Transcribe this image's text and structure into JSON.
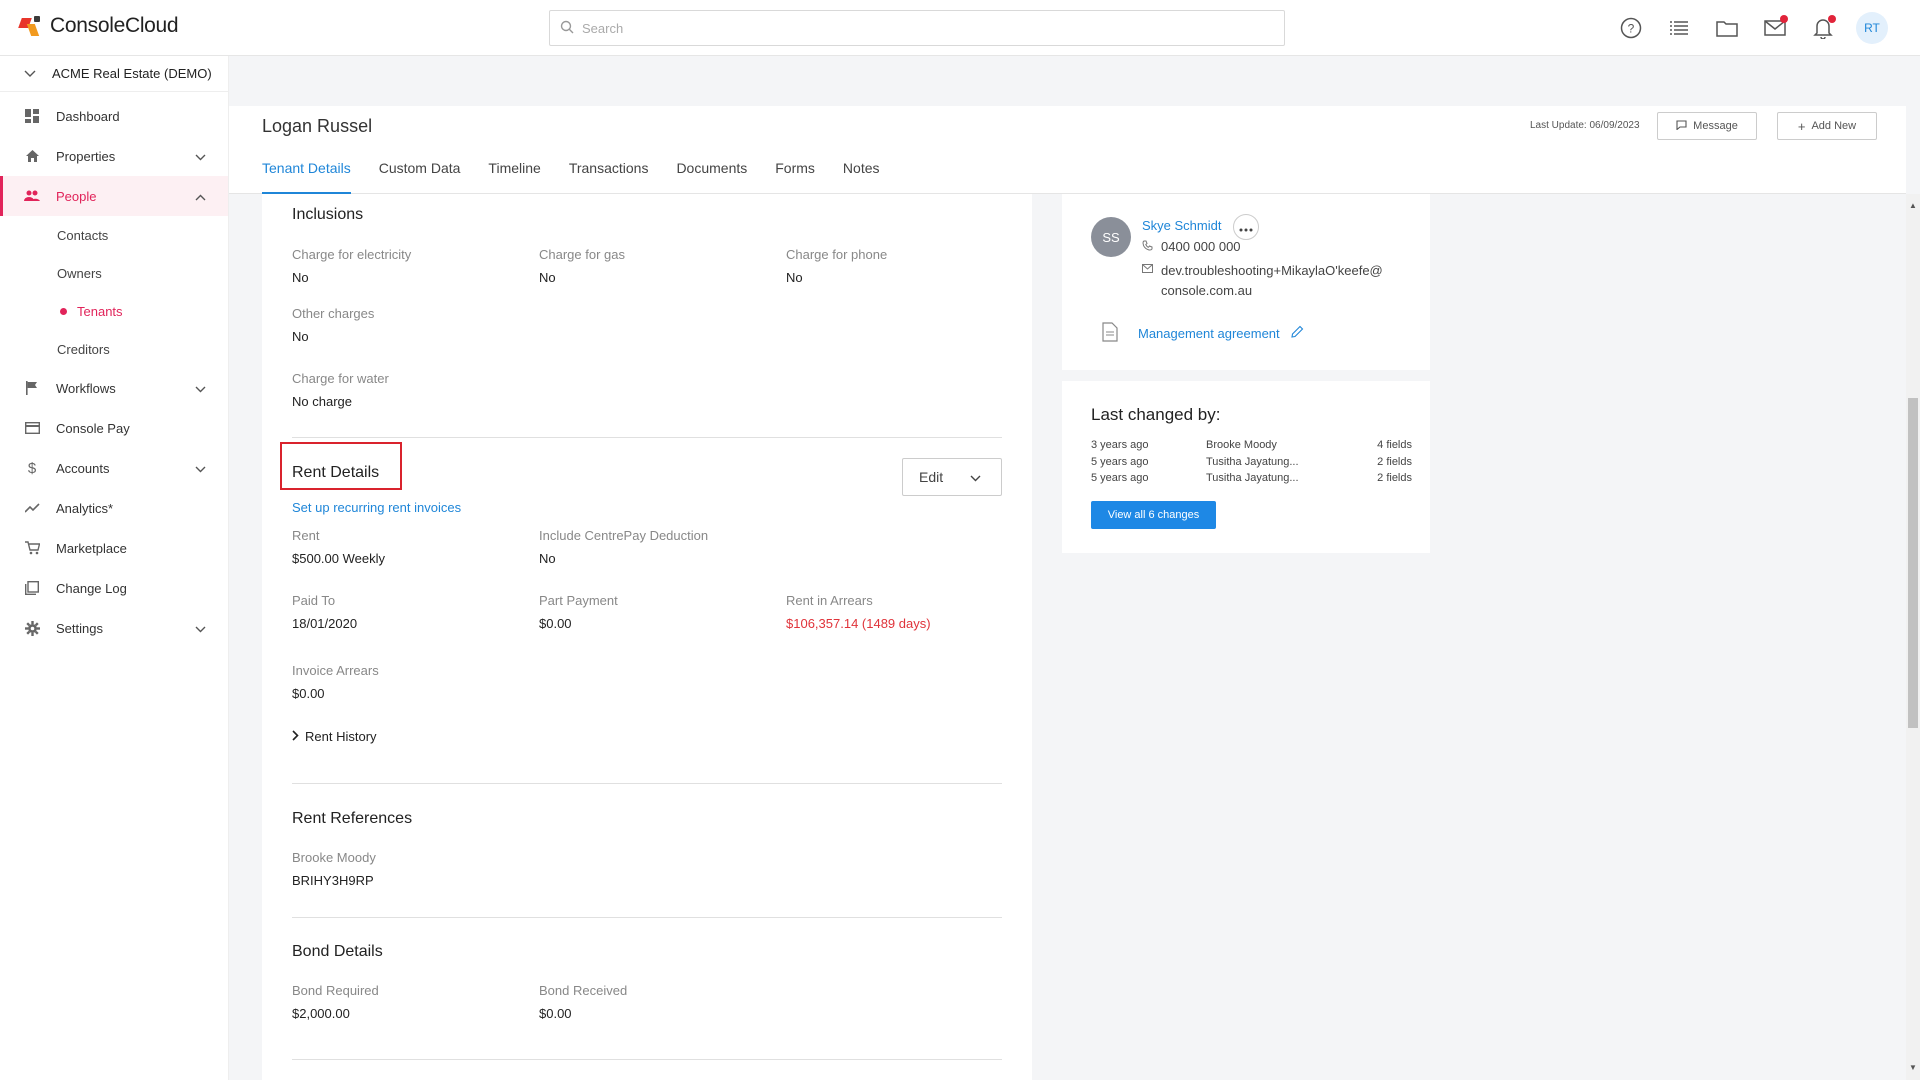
{
  "app": {
    "logo_text": "ConsoleCloud"
  },
  "search": {
    "placeholder": "Search"
  },
  "top_icons": [
    "help-icon",
    "list-icon",
    "folder-icon",
    "mail-icon",
    "bell-icon"
  ],
  "user": {
    "initials": "RT"
  },
  "org": {
    "name": "ACME Real Estate (DEMO)"
  },
  "sidebar": {
    "items": [
      {
        "label": "Dashboard"
      },
      {
        "label": "Properties"
      },
      {
        "label": "People"
      },
      {
        "label": "Workflows"
      },
      {
        "label": "Console Pay"
      },
      {
        "label": "Accounts"
      },
      {
        "label": "Analytics*"
      },
      {
        "label": "Marketplace"
      },
      {
        "label": "Change Log"
      },
      {
        "label": "Settings"
      }
    ],
    "people_sub": [
      "Contacts",
      "Owners",
      "Tenants",
      "Creditors"
    ]
  },
  "header": {
    "title": "Logan Russel",
    "last_update": "Last Update: 06/09/2023",
    "message_label": "Message",
    "add_new_label": "Add New",
    "tabs": [
      "Tenant Details",
      "Custom Data",
      "Timeline",
      "Transactions",
      "Documents",
      "Forms",
      "Notes"
    ]
  },
  "inclusions": {
    "title": "Inclusions",
    "electricity": {
      "label": "Charge for electricity",
      "value": "No"
    },
    "gas": {
      "label": "Charge for gas",
      "value": "No"
    },
    "phone": {
      "label": "Charge for phone",
      "value": "No"
    },
    "other": {
      "label": "Other charges",
      "value": "No"
    },
    "water": {
      "label": "Charge for water",
      "value": "No charge"
    }
  },
  "rent_details": {
    "title": "Rent Details",
    "edit_label": "Edit",
    "recurring_link": "Set up recurring rent invoices",
    "rent": {
      "label": "Rent",
      "value": "$500.00 Weekly"
    },
    "centrepay": {
      "label": "Include CentrePay Deduction",
      "value": "No"
    },
    "paid_to": {
      "label": "Paid To",
      "value": "18/01/2020"
    },
    "part_payment": {
      "label": "Part Payment",
      "value": "$0.00"
    },
    "arrears": {
      "label": "Rent in Arrears",
      "value": "$106,357.14 (1489 days)"
    },
    "invoice_arrears": {
      "label": "Invoice Arrears",
      "value": "$0.00"
    },
    "history_label": "Rent History"
  },
  "rent_references": {
    "title": "Rent References",
    "ref": {
      "label": "Brooke Moody",
      "value": "BRIHY3H9RP"
    }
  },
  "bond_details": {
    "title": "Bond Details",
    "required": {
      "label": "Bond Required",
      "value": "$2,000.00"
    },
    "received": {
      "label": "Bond Received",
      "value": "$0.00"
    }
  },
  "owner": {
    "initials": "SS",
    "name": "Skye Schmidt",
    "phone": "0400 000 000",
    "email_line1": "dev.troubleshooting+MikaylaO'keefe@",
    "email_line2": "console.com.au",
    "agreement_label": "Management agreement"
  },
  "changes": {
    "title": "Last changed by:",
    "rows": [
      {
        "time": "3 years ago",
        "name": "Brooke Moody",
        "fields": "4 fields"
      },
      {
        "time": "5 years ago",
        "name": "Tusitha Jayatung...",
        "fields": "2 fields"
      },
      {
        "time": "5 years ago",
        "name": "Tusitha Jayatung...",
        "fields": "2 fields"
      }
    ],
    "view_all_label": "View all 6 changes"
  },
  "colors": {
    "accent": "#e1245a",
    "link": "#1f86d8",
    "arrears": "#e0333a",
    "highlight": "#d9232d"
  }
}
